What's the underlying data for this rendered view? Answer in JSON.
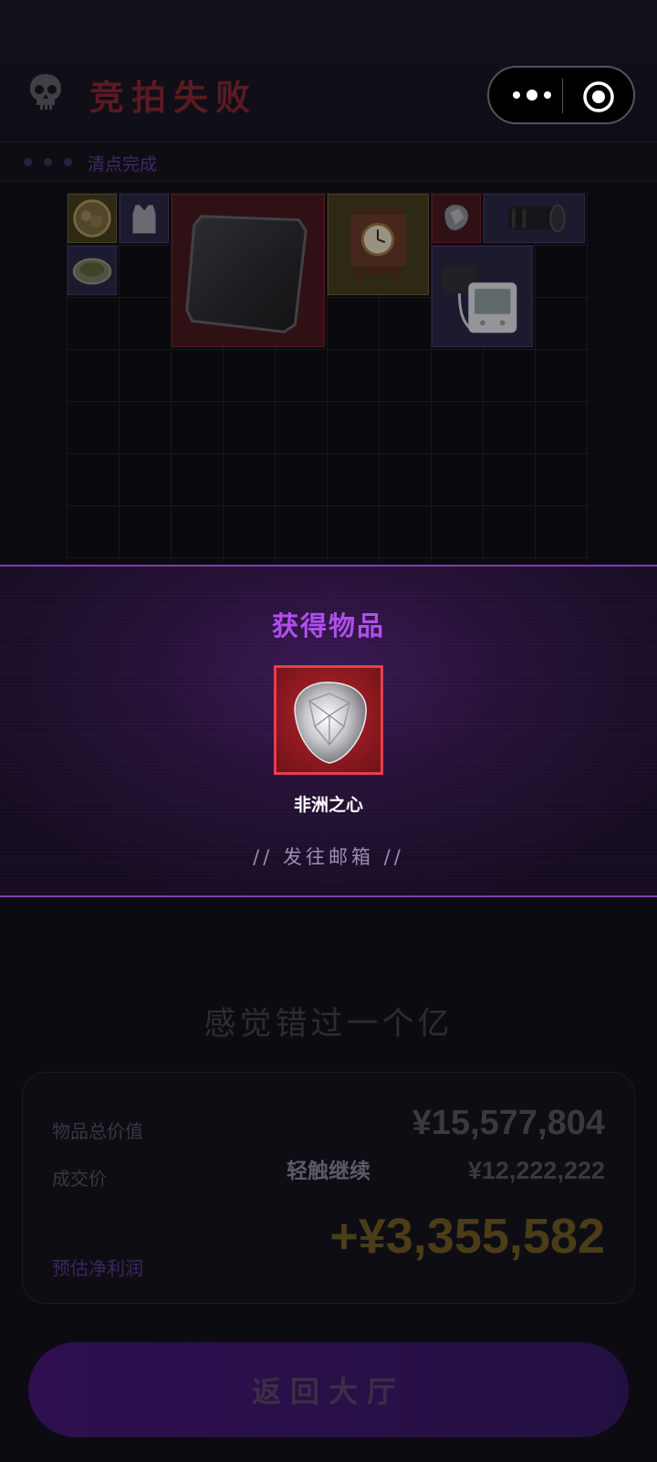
{
  "header": {
    "title": "竞拍失败",
    "status_text": "清点完成"
  },
  "inventory": {
    "items": [
      {
        "name": "coin-tin",
        "rarity": "gold"
      },
      {
        "name": "vest",
        "rarity": "purple"
      },
      {
        "name": "carbon-plate",
        "rarity": "red"
      },
      {
        "name": "mantel-clock",
        "rarity": "gold"
      },
      {
        "name": "gem-small",
        "rarity": "red"
      },
      {
        "name": "camera-lens",
        "rarity": "purple"
      },
      {
        "name": "herb-dish",
        "rarity": "purple"
      },
      {
        "name": "blood-pressure-monitor",
        "rarity": "purple"
      }
    ]
  },
  "popup": {
    "title": "获得物品",
    "item_name": "非洲之心",
    "mail_text": "// 发往邮箱 //"
  },
  "summary": {
    "slogan": "感觉错过一个亿",
    "total_label": "物品总价值",
    "total_value": "¥15,577,804",
    "deal_label": "成交价",
    "deal_value": "¥12,222,222",
    "profit_label": "预估净利润",
    "profit_value": "+¥3,355,582",
    "tap_hint": "轻触继续"
  },
  "actions": {
    "back_label": "返回大厅"
  },
  "colors": {
    "accent": "#b04ef0",
    "rarity_red": "#e0424a",
    "rarity_gold": "#5f5422",
    "rarity_purple": "#3c335a"
  }
}
